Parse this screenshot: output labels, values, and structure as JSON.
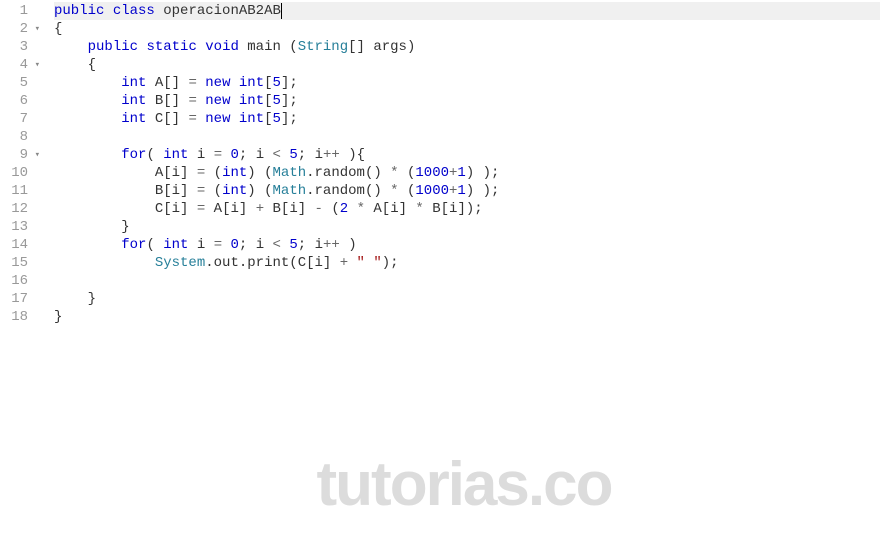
{
  "lines": [
    {
      "num": "1",
      "fold": "",
      "active": true
    },
    {
      "num": "2",
      "fold": "▾",
      "active": false
    },
    {
      "num": "3",
      "fold": "",
      "active": false
    },
    {
      "num": "4",
      "fold": "▾",
      "active": false
    },
    {
      "num": "5",
      "fold": "",
      "active": false
    },
    {
      "num": "6",
      "fold": "",
      "active": false
    },
    {
      "num": "7",
      "fold": "",
      "active": false
    },
    {
      "num": "8",
      "fold": "",
      "active": false
    },
    {
      "num": "9",
      "fold": "▾",
      "active": false
    },
    {
      "num": "10",
      "fold": "",
      "active": false
    },
    {
      "num": "11",
      "fold": "",
      "active": false
    },
    {
      "num": "12",
      "fold": "",
      "active": false
    },
    {
      "num": "13",
      "fold": "",
      "active": false
    },
    {
      "num": "14",
      "fold": "",
      "active": false
    },
    {
      "num": "15",
      "fold": "",
      "active": false
    },
    {
      "num": "16",
      "fold": "",
      "active": false
    },
    {
      "num": "17",
      "fold": "",
      "active": false
    },
    {
      "num": "18",
      "fold": "",
      "active": false
    }
  ],
  "tokens": {
    "public": "public",
    "class": "class",
    "className": "operacionAB2AB",
    "static": "static",
    "void": "void",
    "main": "main",
    "String": "String",
    "args": "args",
    "int": "int",
    "A": "A",
    "B": "B",
    "C": "C",
    "new": "new",
    "five": "5",
    "for": "for",
    "i": "i",
    "zero": "0",
    "two": "2",
    "Math": "Math",
    "random": "random",
    "thousand": "1000",
    "one": "1",
    "System": "System",
    "out": "out",
    "print": "print",
    "space": "\" \"",
    "openBrace": "{",
    "closeBrace": "}",
    "openParen": "(",
    "closeParen": ")",
    "openBracket": "[",
    "closeBracket": "]",
    "semicolon": ";",
    "equals": "=",
    "lt": "<",
    "inc": "++",
    "star": "*",
    "plus": "+",
    "minus": "-",
    "dot": "."
  },
  "watermark": "tutorias.co"
}
